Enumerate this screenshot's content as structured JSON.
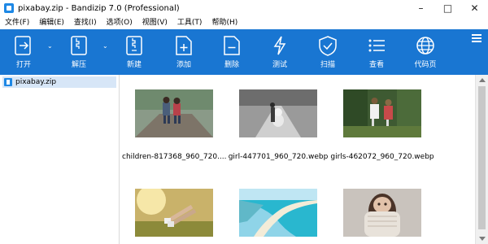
{
  "window": {
    "title": "pixabay.zip - Bandizip 7.0 (Professional)",
    "controls": {
      "minimize": "–",
      "maximize": "□",
      "close": "✕"
    }
  },
  "menu": {
    "items": [
      "文件(F)",
      "编辑(E)",
      "查找(I)",
      "选项(O)",
      "视图(V)",
      "工具(T)",
      "帮助(H)"
    ]
  },
  "toolbar": {
    "bg_color": "#1976d2",
    "buttons": [
      {
        "label": "打开",
        "icon": "open-icon"
      },
      {
        "label": "解压",
        "icon": "extract-icon"
      },
      {
        "label": "新建",
        "icon": "new-archive-icon"
      },
      {
        "label": "添加",
        "icon": "add-file-icon"
      },
      {
        "label": "删除",
        "icon": "delete-file-icon"
      },
      {
        "label": "测试",
        "icon": "test-icon"
      },
      {
        "label": "扫描",
        "icon": "scan-shield-icon"
      },
      {
        "label": "查看",
        "icon": "view-list-icon"
      },
      {
        "label": "代码页",
        "icon": "codepage-globe-icon"
      }
    ]
  },
  "sidebar": {
    "items": [
      {
        "label": "pixabay.zip",
        "selected": true
      }
    ]
  },
  "files": [
    {
      "name": "children-817368_960_720....",
      "image": "two children on a path"
    },
    {
      "name": "girl-447701_960_720.webp",
      "image": "girl with teddy bear on road (grayscale)"
    },
    {
      "name": "girls-462072_960_720.webp",
      "image": "two girls in forest"
    },
    {
      "name": "",
      "image": "legs in grass with sunlight"
    },
    {
      "name": "",
      "image": "tropical beach with turquoise water"
    },
    {
      "name": "",
      "image": "woman with sweater over face"
    }
  ]
}
